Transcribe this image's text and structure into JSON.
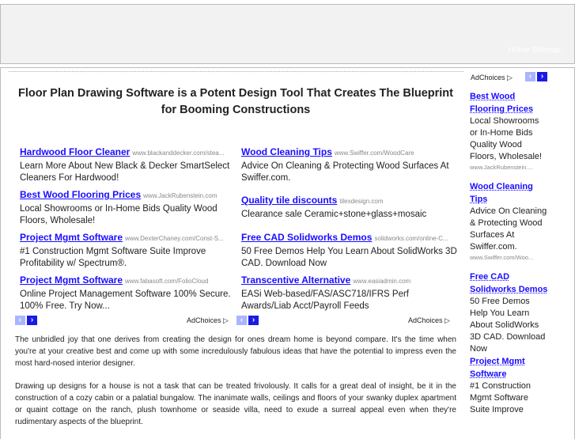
{
  "header": {
    "nav": [
      "Home",
      "Sitemap"
    ]
  },
  "title": "Floor Plan Drawing Software is a Potent Design Tool That Creates The Blueprint for Booming Constructions",
  "ads_left": [
    {
      "title": "Hardwood Floor Cleaner",
      "url": "www.blackanddecker.com/stea...",
      "desc": "Learn More About New Black & Decker SmartSelect Cleaners For Hardwood!"
    },
    {
      "title": "Best Wood Flooring Prices",
      "url": "www.JackRubenstein.com",
      "desc": "Local Showrooms or In-Home Bids Quality Wood Floors, Wholesale!"
    },
    {
      "title": "Project Mgmt Software",
      "url": "www.DexterChaney.com/Const-S...",
      "desc": "#1 Construction Mgmt Software Suite Improve Profitability w/ Spectrum®."
    },
    {
      "title": "Project Mgmt Software",
      "url": "www.fabasoft.com/FolioCloud",
      "desc": "Online Project Management Software 100% Secure. 100% Free. Try Now..."
    }
  ],
  "ads_right": [
    {
      "title": "Wood Cleaning Tips",
      "url": "www.Swiffer.com/WoodCare",
      "desc": "Advice On Cleaning & Protecting Wood Surfaces At Swiffer.com."
    },
    {
      "title": "Quality tile discounts",
      "url": "tilexdesign.com",
      "desc": "Clearance sale Ceramic+stone+glass+mosaic"
    },
    {
      "title": "Free CAD Solidworks Demos",
      "url": "solidworks.com/online-C...",
      "desc": "50 Free Demos Help You Learn About SolidWorks 3D CAD. Download Now"
    },
    {
      "title": "Transcentive Alternative",
      "url": "www.easiadmin.com",
      "desc": "EASi Web-based/FAS/ASC718/IFRS Perf Awards/Liab Acct/Payroll Feeds"
    }
  ],
  "adchoices": "AdChoices ▷",
  "prev": "‹",
  "next": "›",
  "paragraphs": [
    "The unbridled joy that one derives from creating the design for ones dream home is beyond compare. It's the time when you're at your creative best and come up with some incredulously fabulous ideas that have the potential to impress even the most hard-nosed interior designer.",
    "Drawing up designs for a house is not a task that can be treated frivolously. It calls for a great deal of insight, be it in the construction of a cozy cabin or a palatial bungalow. The inanimate walls, ceilings and floors of your swanky duplex apartment or quaint cottage on the ranch, plush townhome or seaside villa, need to exude a surreal appeal even when they're rudimentary aspects of the blueprint."
  ],
  "sidebar_ads": [
    {
      "title": "Best Wood Flooring Prices",
      "desc": "Local Showrooms or In-Home Bids Quality Wood Floors, Wholesale!",
      "url": "www.JackRubenstein...."
    },
    {
      "title": "Wood Cleaning Tips",
      "desc": "Advice On Cleaning & Protecting Wood Surfaces At Swiffer.com.",
      "url": "www.Swiffer.com/Woo..."
    },
    {
      "title": "Free CAD Solidworks Demos",
      "desc": "50 Free Demos Help You Learn About SolidWorks 3D CAD. Download Now",
      "url": ""
    },
    {
      "title": "Project Mgmt Software",
      "desc": "#1 Construction Mgmt Software Suite Improve",
      "url": ""
    }
  ]
}
